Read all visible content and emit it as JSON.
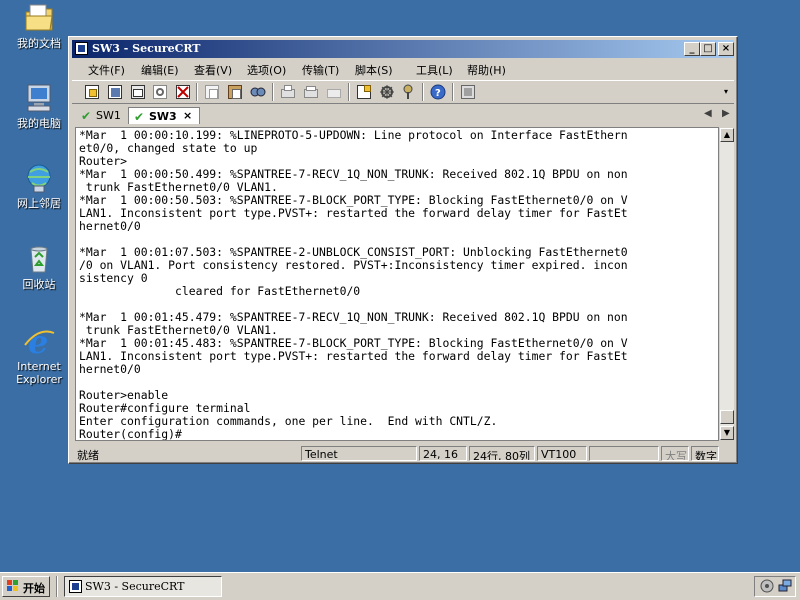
{
  "desktop": {
    "icons": [
      {
        "label": "我的文档",
        "icon": "my-documents-icon"
      },
      {
        "label": "我的电脑",
        "icon": "my-computer-icon"
      },
      {
        "label": "网上邻居",
        "icon": "network-icon"
      },
      {
        "label": "回收站",
        "icon": "recycle-bin-icon"
      },
      {
        "label_line1": "Internet",
        "label_line2": "Explorer",
        "icon": "ie-icon"
      }
    ]
  },
  "window": {
    "title": "SW3 - SecureCRT",
    "controls": {
      "minimize": "_",
      "maximize": "□",
      "close": "×"
    },
    "menu": [
      "文件(F)",
      "编辑(E)",
      "查看(V)",
      "选项(O)",
      "传输(T)",
      "脚本(S)",
      "工具(L)",
      "帮助(H)"
    ],
    "toolbar_icons": [
      "connect-icon",
      "quick-connect-icon",
      "connect-tab-icon",
      "reconnect-icon",
      "disconnect-icon",
      "copy-icon",
      "paste-icon",
      "find-icon",
      "print-icon",
      "print-selection-icon",
      "print-setup-icon",
      "session-options-icon",
      "global-options-icon",
      "keymap-icon",
      "help-icon",
      "sftp-icon"
    ],
    "tabs": [
      {
        "label": "SW1",
        "active": false
      },
      {
        "label": "SW3",
        "active": true,
        "close": "×"
      }
    ],
    "tab_nav": {
      "left": "◀",
      "right": "▶"
    },
    "terminal_lines": [
      "*Mar  1 00:00:10.199: %LINEPROTO-5-UPDOWN: Line protocol on Interface FastEthern",
      "et0/0, changed state to up",
      "Router>",
      "*Mar  1 00:00:50.499: %SPANTREE-7-RECV_1Q_NON_TRUNK: Received 802.1Q BPDU on non",
      " trunk FastEthernet0/0 VLAN1.",
      "*Mar  1 00:00:50.503: %SPANTREE-7-BLOCK_PORT_TYPE: Blocking FastEthernet0/0 on V",
      "LAN1. Inconsistent port type.PVST+: restarted the forward delay timer for FastEt",
      "hernet0/0",
      "",
      "*Mar  1 00:01:07.503: %SPANTREE-2-UNBLOCK_CONSIST_PORT: Unblocking FastEthernet0",
      "/0 on VLAN1. Port consistency restored. PVST+:Inconsistency timer expired. incon",
      "sistency 0",
      "              cleared for FastEthernet0/0",
      "",
      "*Mar  1 00:01:45.479: %SPANTREE-7-RECV_1Q_NON_TRUNK: Received 802.1Q BPDU on non",
      " trunk FastEthernet0/0 VLAN1.",
      "*Mar  1 00:01:45.483: %SPANTREE-7-BLOCK_PORT_TYPE: Blocking FastEthernet0/0 on V",
      "LAN1. Inconsistent port type.PVST+: restarted the forward delay timer for FastEt",
      "hernet0/0",
      "",
      "Router>enable",
      "Router#configure terminal",
      "Enter configuration commands, one per line.  End with CNTL/Z.",
      "Router(config)#"
    ],
    "status": {
      "ready": "就绪",
      "protocol": "Telnet",
      "cursor": "24, 16",
      "size": "24行, 80列",
      "emulation": "VT100",
      "empty": "",
      "caps": "大写",
      "num": "数字"
    }
  },
  "taskbar": {
    "start_label": "开始",
    "task_title": "SW3 - SecureCRT"
  }
}
